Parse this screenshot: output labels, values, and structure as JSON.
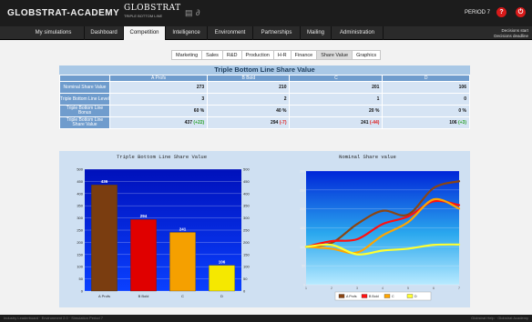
{
  "app": {
    "brand": "GLOBSTRAT-ACADEMY",
    "logo_text": "GLOBSTRAT",
    "logo_sub": "TRIPLE BOTTOM LINE",
    "period": "PERIOD 7",
    "decisions_line1": "Decisions start",
    "decisions_line2": "Decisions deadline"
  },
  "nav": {
    "tabs": [
      {
        "label": "My simulations"
      },
      {
        "label": "Dashboard"
      },
      {
        "label": "Competition"
      },
      {
        "label": "Intelligence"
      },
      {
        "label": "Environment"
      },
      {
        "label": "Partnerships"
      },
      {
        "label": "Mailing"
      },
      {
        "label": "Administration"
      }
    ],
    "active": "Competition"
  },
  "subnav": {
    "tabs": [
      {
        "label": "Marketing"
      },
      {
        "label": "Sales"
      },
      {
        "label": "R&D"
      },
      {
        "label": "Production"
      },
      {
        "label": "H-R"
      },
      {
        "label": "Finance"
      },
      {
        "label": "Share Value"
      },
      {
        "label": "Graphics"
      }
    ],
    "active": "Share Value"
  },
  "table": {
    "title": "Triple Bottom Line Share Value",
    "columns": [
      "A Profs",
      "B Bold",
      "C",
      "D"
    ],
    "rows": [
      {
        "label": "Nominal Share Value",
        "cells": [
          {
            "v": "273",
            "d": ""
          },
          {
            "v": "210",
            "d": ""
          },
          {
            "v": "201",
            "d": ""
          },
          {
            "v": "106",
            "d": ""
          }
        ]
      },
      {
        "label": "Triple Bottom Line Level",
        "cells": [
          {
            "v": "3",
            "d": ""
          },
          {
            "v": "2",
            "d": ""
          },
          {
            "v": "1",
            "d": ""
          },
          {
            "v": "0",
            "d": ""
          }
        ]
      },
      {
        "label": "Triple Bottom Line Bonus",
        "cells": [
          {
            "v": "60 %",
            "d": ""
          },
          {
            "v": "40 %",
            "d": ""
          },
          {
            "v": "20 %",
            "d": ""
          },
          {
            "v": "0 %",
            "d": ""
          }
        ]
      },
      {
        "label": "Triple Bottom Line Share Value",
        "cells": [
          {
            "v": "437",
            "d": "(+22)",
            "s": "pos"
          },
          {
            "v": "294",
            "d": "(-7)",
            "s": "neg"
          },
          {
            "v": "241",
            "d": "(-44)",
            "s": "neg"
          },
          {
            "v": "106",
            "d": "(+3)",
            "s": "pos"
          }
        ]
      }
    ]
  },
  "chart_data": [
    {
      "type": "bar",
      "title": "Triple Bottom Line Share Value",
      "categories": [
        "A Profs",
        "B Bold",
        "C",
        "D"
      ],
      "values": [
        436,
        294,
        241,
        106
      ],
      "colors": [
        "#7a3d10",
        "#e00000",
        "#f5a000",
        "#f5e800"
      ],
      "ylim": [
        0,
        500
      ],
      "yticks": [
        0,
        50,
        100,
        150,
        200,
        250,
        300,
        350,
        400,
        450,
        500
      ]
    },
    {
      "type": "line",
      "title": "Nominal Share value",
      "x": [
        1,
        2,
        3,
        4,
        5,
        6,
        7
      ],
      "ylim": [
        0,
        300
      ],
      "yticks": [
        0,
        50,
        100,
        150,
        200,
        250,
        300
      ],
      "series": [
        {
          "name": "A Profs",
          "color": "#8b4513",
          "values": [
            100,
            110,
            160,
            195,
            185,
            255,
            273
          ]
        },
        {
          "name": "B Bold",
          "color": "#ff1010",
          "values": [
            100,
            115,
            120,
            160,
            180,
            220,
            210
          ]
        },
        {
          "name": "C",
          "color": "#ffa500",
          "values": [
            100,
            95,
            85,
            130,
            165,
            225,
            201
          ]
        },
        {
          "name": "D",
          "color": "#ffff30",
          "values": [
            100,
            105,
            80,
            90,
            95,
            105,
            106
          ]
        }
      ]
    }
  ],
  "footer": {
    "left": "Industry Leaderboard · Environment 2.0 · Simulation Period 7",
    "right": "Globstrat Help · Globstrat Academy"
  }
}
